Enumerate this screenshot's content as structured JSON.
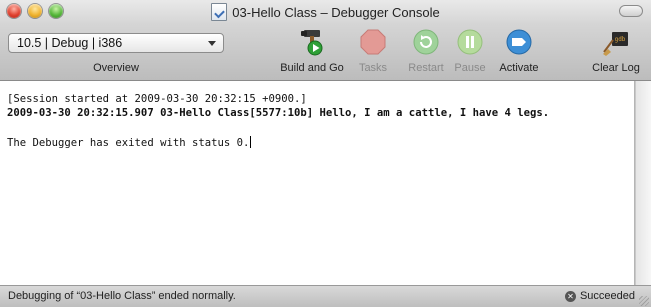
{
  "window": {
    "title": "03-Hello Class – Debugger Console"
  },
  "overview": {
    "selected": "10.5 | Debug | i386",
    "label": "Overview"
  },
  "toolbar": {
    "build_and_go": "Build and Go",
    "tasks": "Tasks",
    "restart": "Restart",
    "pause": "Pause",
    "activate": "Activate",
    "clear_log": "Clear Log"
  },
  "console": {
    "session_line": "[Session started at 2009-03-30 20:32:15 +0900.]",
    "output_line": "2009-03-30 20:32:15.907 03-Hello Class[5577:10b] Hello, I am a cattle, I have 4 legs.",
    "exit_line": "The Debugger has exited with status 0."
  },
  "status": {
    "message": "Debugging of “03-Hello Class” ended normally.",
    "result": "Succeeded"
  }
}
